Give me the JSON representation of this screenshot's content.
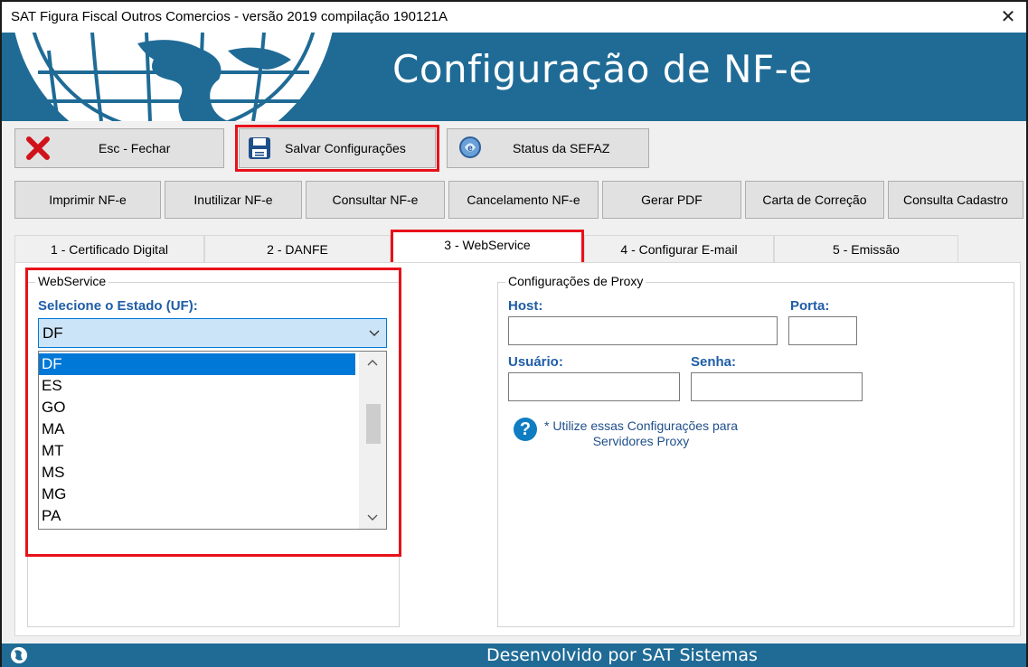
{
  "window": {
    "title": "SAT Figura Fiscal Outros Comercios - versão 2019 compilação 190121A",
    "close_glyph": "✕"
  },
  "banner": {
    "heading": "Configuração de NF-e",
    "colors": {
      "background": "#1f6b96",
      "accent_red": "#e8111a"
    }
  },
  "toolbar": {
    "close_label": "Esc - Fechar",
    "save_label": "Salvar Configurações",
    "sefaz_label": "Status da SEFAZ",
    "icons": [
      "close-x-icon",
      "floppy-disk-icon",
      "sefaz-status-icon"
    ]
  },
  "nfe_toolbar": {
    "buttons": [
      "Imprimir NF-e",
      "Inutilizar NF-e",
      "Consultar NF-e",
      "Cancelamento NF-e",
      "Gerar PDF",
      "Carta de Correção",
      "Consulta Cadastro"
    ]
  },
  "tabs": [
    "1 - Certificado Digital",
    "2 - DANFE",
    "3 - WebService",
    "4 - Configurar E-mail",
    "5 - Emissão"
  ],
  "active_tab": "3 - WebService",
  "webservice": {
    "group_title": "WebService",
    "state_label": "Selecione o Estado (UF):",
    "selected_state": "DF",
    "options": [
      "DF",
      "ES",
      "GO",
      "MA",
      "MT",
      "MS",
      "MG",
      "PA"
    ]
  },
  "proxy": {
    "group_title": "Configurações de Proxy",
    "host_label": "Host:",
    "port_label": "Porta:",
    "user_label": "Usuário:",
    "password_label": "Senha:",
    "host_value": "",
    "port_value": "",
    "user_value": "",
    "password_value": "",
    "help_line1": "* Utilize essas Configurações para",
    "help_line2": "Servidores Proxy"
  },
  "footer": {
    "text": "Desenvolvido por SAT Sistemas"
  }
}
